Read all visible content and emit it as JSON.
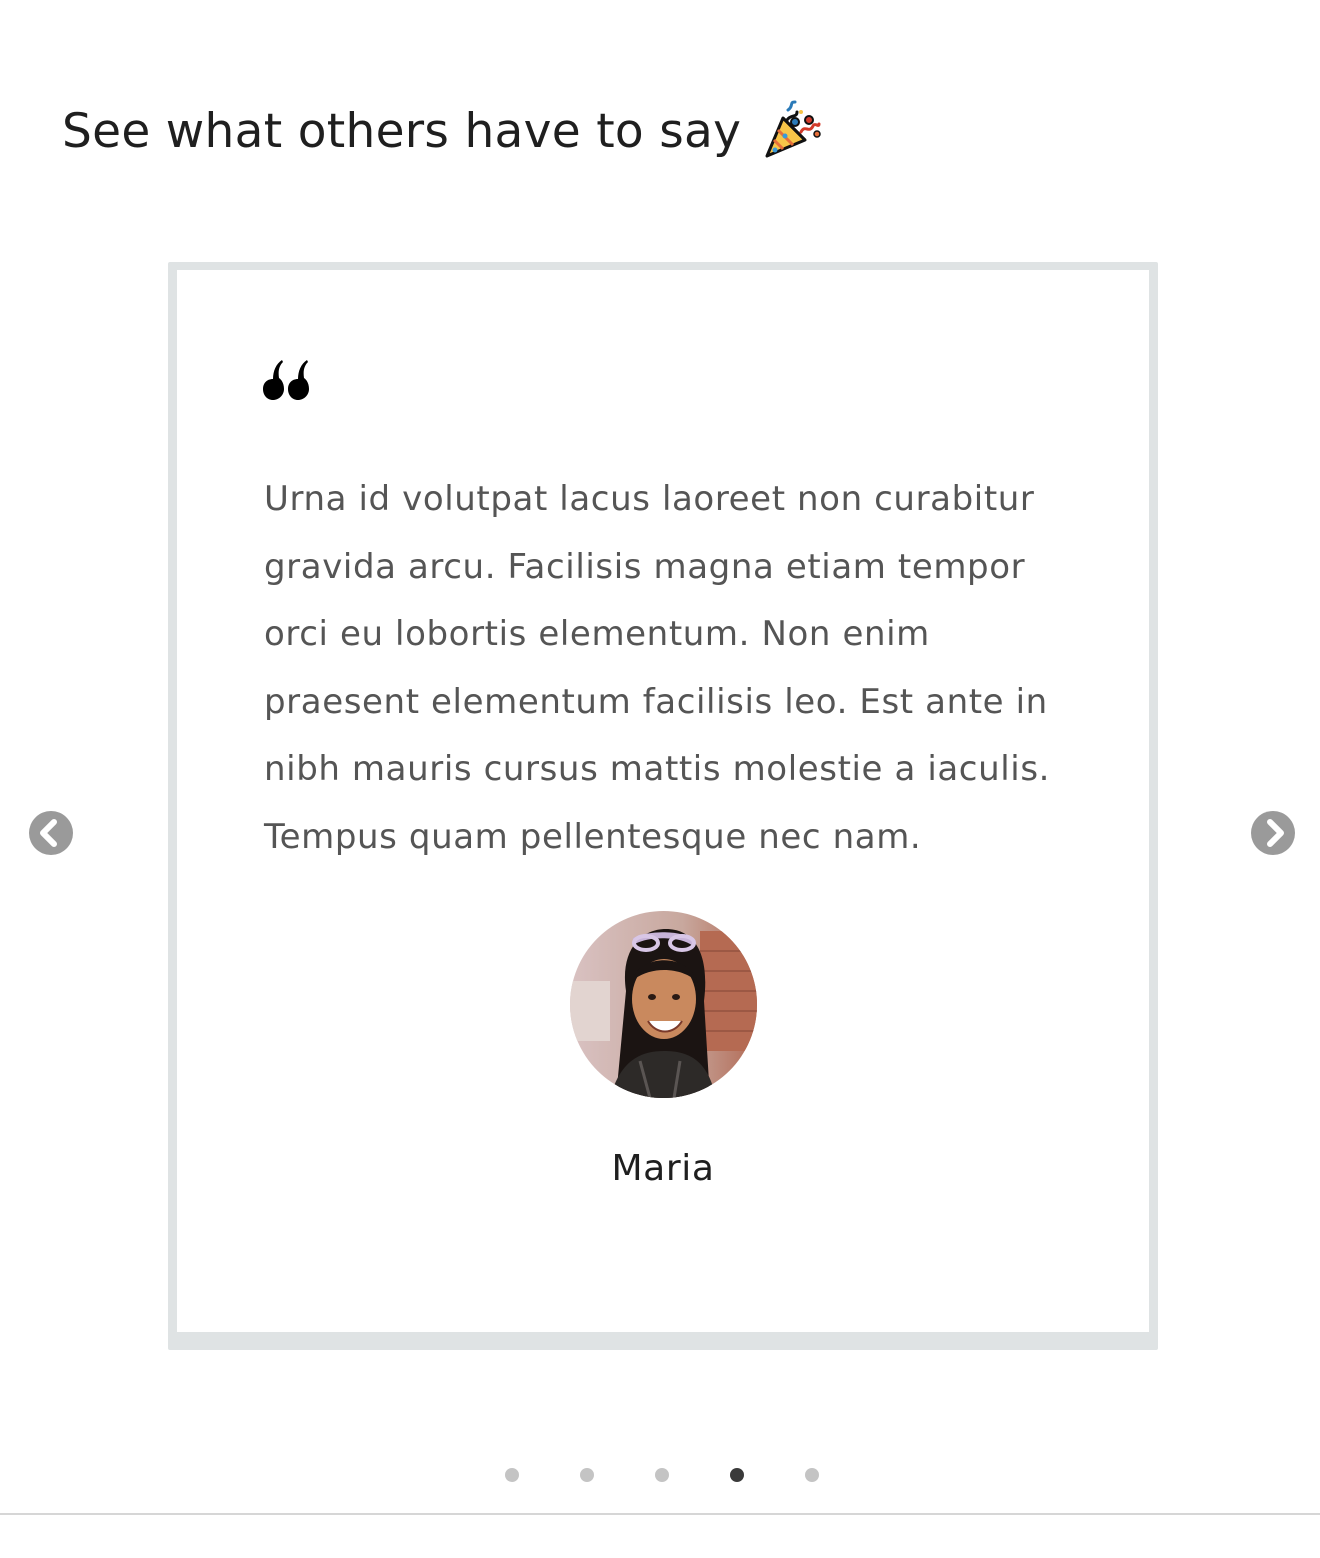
{
  "section": {
    "heading": "See what others have to say",
    "heading_emoji_icon": "party-popper-icon"
  },
  "testimonial": {
    "quote_icon": "quote-open-icon",
    "text": "Urna id volutpat lacus laoreet non curabitur gravida arcu. Facilisis magna etiam tempor orci eu lobortis elementum. Non enim praesent elementum facilisis leo. Est ante in nibh mauris cursus mattis molestie a iaculis. Tempus quam pellentesque nec nam.",
    "author": "Maria",
    "avatar_icon": "avatar-photo"
  },
  "carousel": {
    "prev_icon": "chevron-left-circle-icon",
    "next_icon": "chevron-right-circle-icon",
    "slide_count": 5,
    "active_index": 3
  },
  "colors": {
    "dot_inactive": "#c4c4c4",
    "dot_active": "#3a3a3a",
    "arrow": "#9a9a9a",
    "text": "#555555",
    "heading": "#1f1f1f"
  }
}
